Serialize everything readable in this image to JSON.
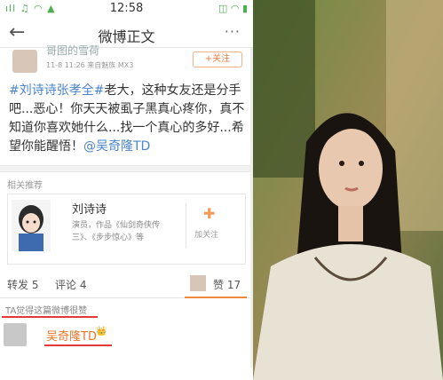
{
  "status": {
    "time": "12:58",
    "left": "ıll ♫ ◠ ▲",
    "right": "◫ ◠ ▮"
  },
  "nav": {
    "back": "←",
    "title": "微博正文",
    "more": "···"
  },
  "post": {
    "username": "哥图的雪荷",
    "meta": "11-8 11:26 来自魅族 MX3",
    "follow": "+关注",
    "hashtag": "#刘诗诗张孝全#",
    "text": "老大，这种女友还是分手吧...恶心！你天天被虱子黑真心疼你，真不知道你喜欢她什么...找一个真心的多好...希望你能醒悟！",
    "mention": "@吴奇隆TD"
  },
  "recommend": {
    "title": "相关推荐",
    "name": "刘诗诗",
    "desc": "演员，作品《仙剑奇侠传三》、《步步惊心》等",
    "add_label": "加关注",
    "add_icon": "✚"
  },
  "actions": {
    "repost": "转发 5",
    "comment": "评论 4",
    "like": "赞 17"
  },
  "liked": {
    "caption": "TA觉得这篇微博很赞",
    "liker_name": "吴奇隆TD",
    "vip": "👑"
  },
  "colors": {
    "accent": "#f27b3c",
    "link": "#4a84c8",
    "underline": "#e53935"
  }
}
